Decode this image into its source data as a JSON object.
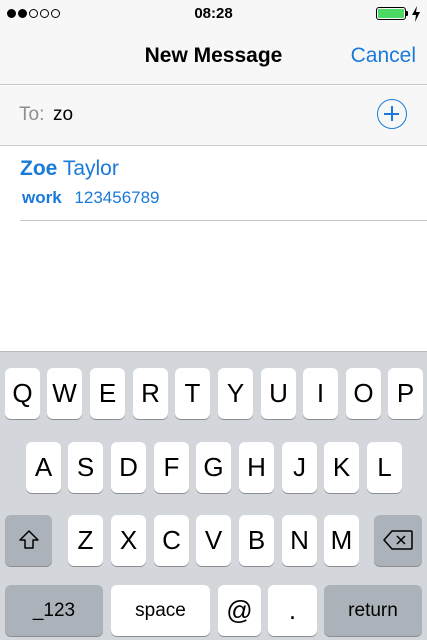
{
  "status_bar": {
    "time": "08:28",
    "signal_bars_filled": 2,
    "signal_bars_total": 5,
    "battery_color": "#4cd964",
    "charging_icon": "bolt-icon"
  },
  "nav": {
    "title": "New Message",
    "cancel_label": "Cancel",
    "accent_color": "#1a7ad9"
  },
  "compose": {
    "to_label": "To:",
    "to_value": "zo",
    "add_icon": "plus-circle-icon"
  },
  "suggestion": {
    "first_name": "Zoe",
    "last_name": "Taylor",
    "phone_type": "work",
    "phone_number": "123456789"
  },
  "keyboard": {
    "row1": [
      "Q",
      "W",
      "E",
      "R",
      "T",
      "Y",
      "U",
      "I",
      "O",
      "P"
    ],
    "row2": [
      "A",
      "S",
      "D",
      "F",
      "G",
      "H",
      "J",
      "K",
      "L"
    ],
    "row3": [
      "Z",
      "X",
      "C",
      "V",
      "B",
      "N",
      "M"
    ],
    "shift_icon": "shift-icon",
    "delete_icon": "backspace-icon",
    "numbers_label": "_123",
    "space_label": "space",
    "at_label": "@",
    "period_label": ".",
    "return_label": "return"
  }
}
